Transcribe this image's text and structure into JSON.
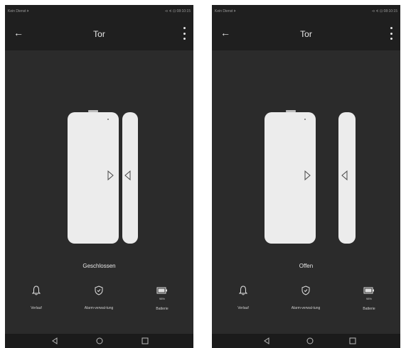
{
  "screens": [
    {
      "status": {
        "left": "Kein Dienst ⏵",
        "right": "⊲ ∢ ⊡ 08:10:15"
      },
      "title": "Tor",
      "state": "Geschlossen",
      "actions": [
        {
          "label": "Verlauf",
          "icon": "bell-icon"
        },
        {
          "label": "Alarm-verwal-tung",
          "icon": "shield-icon"
        },
        {
          "label": "Batterie",
          "icon": "battery-icon",
          "value": "98%"
        }
      ]
    },
    {
      "status": {
        "left": "Kein Dienst ⏵",
        "right": "⊲ ∢ ⊡ 08:10:15"
      },
      "title": "Tor",
      "state": "Offen",
      "actions": [
        {
          "label": "Verlauf",
          "icon": "bell-icon"
        },
        {
          "label": "Alarm-verwal-tung",
          "icon": "shield-icon"
        },
        {
          "label": "Batterie",
          "icon": "battery-icon",
          "value": "98%"
        }
      ]
    }
  ],
  "colors": {
    "background": "#2b2b2b",
    "bar": "#1f1f1f",
    "device": "#ececec",
    "text": "#e8e8e8"
  }
}
